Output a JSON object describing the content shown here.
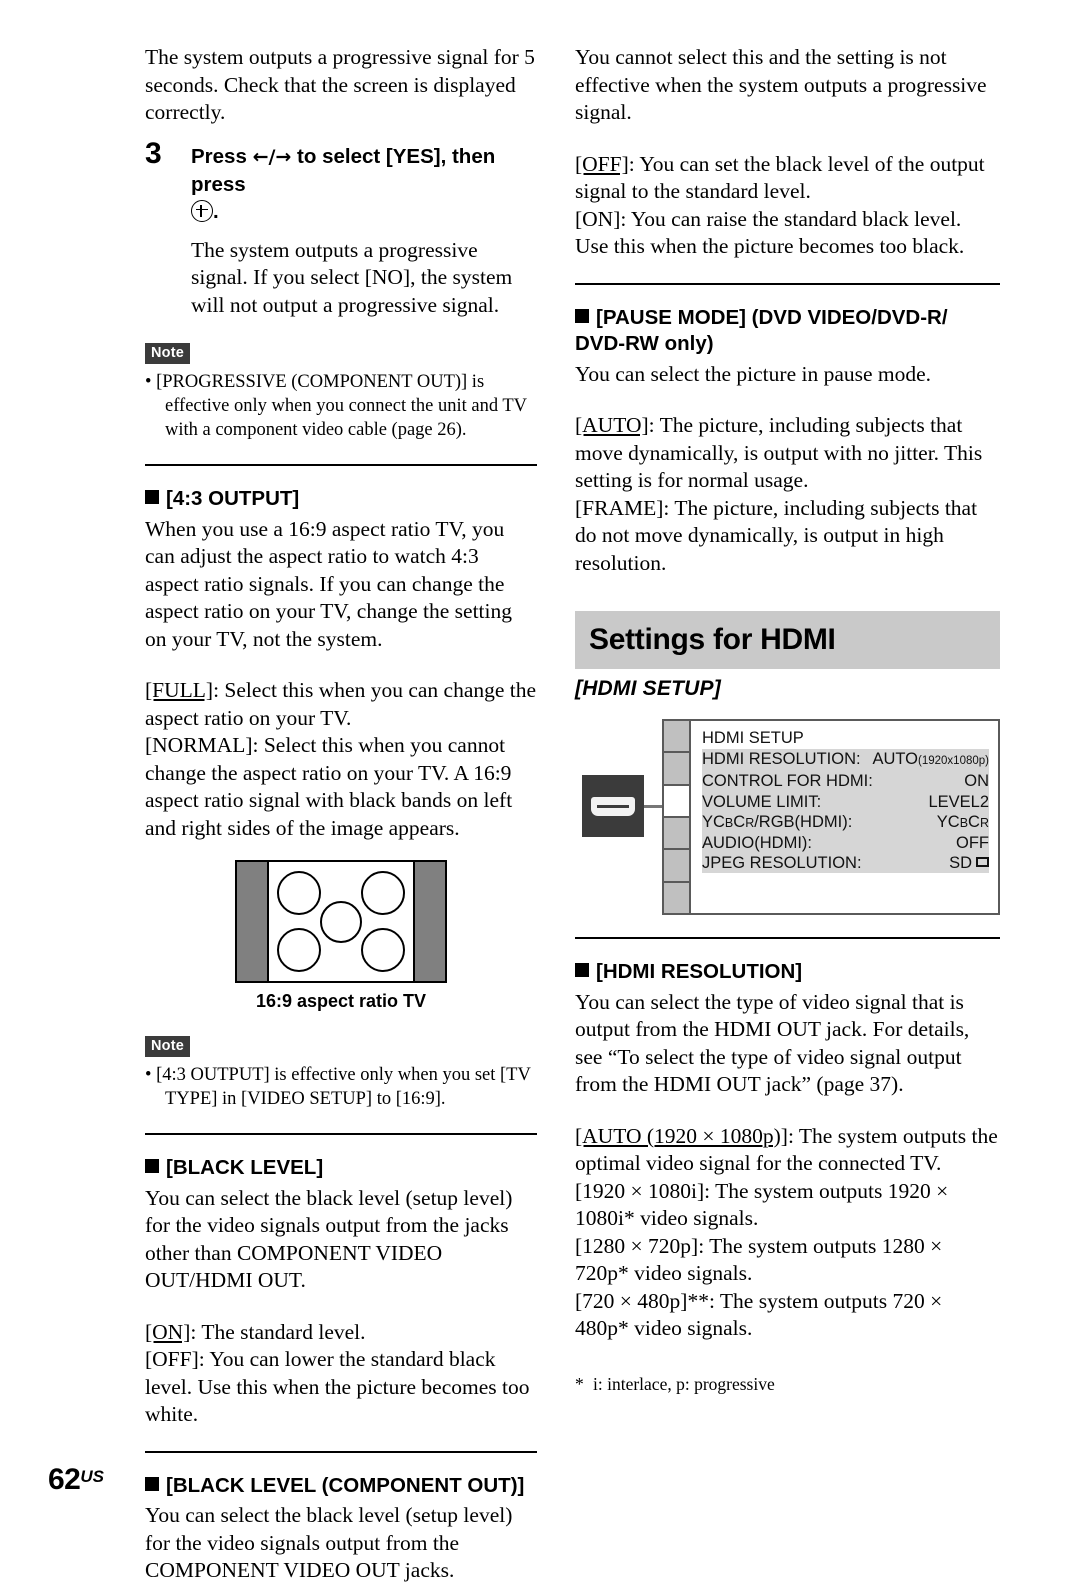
{
  "page": {
    "number": "62",
    "region_suffix": "US"
  },
  "left_column": {
    "intro_paragraph": "The system outputs a progressive signal for 5 seconds. Check that the screen is displayed correctly.",
    "step": {
      "number": "3",
      "heading_before_arrows": "Press ",
      "arrows": "←/→",
      "heading_after_arrows": " to select [YES], then press",
      "heading_tail": ".",
      "body": "The system outputs a progressive signal. If you select [NO], the system will not output a progressive signal."
    },
    "note1": {
      "badge": "Note",
      "text": "• [PROGRESSIVE (COMPONENT OUT)] is",
      "continuation": "effective only when you connect the unit and TV with a component video cable (page 26)."
    },
    "section_43_output": {
      "heading": "[4:3 OUTPUT]",
      "body": "When you use a 16:9 aspect ratio TV, you can adjust the aspect ratio to watch 4:3 aspect ratio signals. If you can change the aspect ratio on your TV, change the setting on your TV, not the system.",
      "option_full_label": "[FULL]",
      "option_full_text": ": Select this when you can change the aspect ratio on your TV.",
      "option_normal_label": "[NORMAL]",
      "option_normal_text": ": Select this when you cannot change the aspect ratio on your TV. A 16:9 aspect ratio signal with black bands on left and right sides of the image appears."
    },
    "tv_figure": {
      "caption": "16:9 aspect ratio TV"
    },
    "note2": {
      "badge": "Note",
      "text": "• [4:3 OUTPUT] is effective only when you set [TV",
      "continuation": "TYPE] in [VIDEO SETUP] to [16:9]."
    },
    "section_black_level": {
      "heading": "[BLACK LEVEL]",
      "body": "You can select the black level (setup level) for the video signals output from the jacks other than COMPONENT VIDEO OUT/HDMI OUT.",
      "option_on_label": "[ON]",
      "option_on_text": ": The standard level.",
      "option_off_label": "[OFF]",
      "option_off_text": ": You can lower the standard black level. Use this when the picture becomes too white."
    },
    "section_black_level_component": {
      "heading": "[BLACK LEVEL (COMPONENT OUT)]",
      "body": "You can select the black level (setup level) for the video signals output from the COMPONENT VIDEO OUT jacks."
    }
  },
  "right_column": {
    "intro_paragraph": "You cannot select this and the setting is not effective when the system outputs a progressive signal.",
    "black_level_component_options": {
      "option_off_label": "[OFF]",
      "option_off_text": ": You can set the black level of the output signal to the standard level.",
      "option_on_label": "[ON]",
      "option_on_text": ": You can raise the standard black level. Use this when the picture becomes too black."
    },
    "section_pause_mode": {
      "heading_line1": "[PAUSE MODE] (DVD VIDEO/DVD-R/",
      "heading_line2": "DVD-RW only)",
      "body": "You can select the picture in pause mode.",
      "option_auto_label": "[AUTO]",
      "option_auto_text": ": The picture, including subjects that move dynamically, is output with no jitter. This setting is for normal usage.",
      "option_frame_label": "[FRAME]",
      "option_frame_text": ": The picture, including subjects that do not move dynamically, is output in high resolution."
    },
    "band_title": "Settings for HDMI",
    "subsection_title": "[HDMI SETUP]",
    "osd": {
      "icon_label": "hdmi-connector-icon",
      "tabs": [
        {
          "selected": false
        },
        {
          "selected": false
        },
        {
          "selected": true
        },
        {
          "selected": false
        },
        {
          "selected": false
        },
        {
          "selected": false
        }
      ],
      "title": "HDMI SETUP",
      "rows": [
        {
          "label": "HDMI RESOLUTION:",
          "value": "AUTO",
          "value_small": "(1920x1080p)"
        },
        {
          "label": "CONTROL FOR HDMI:",
          "value": "ON",
          "value_small": ""
        },
        {
          "label": "VOLUME LIMIT:",
          "value": "LEVEL2",
          "value_small": ""
        },
        {
          "label": "YCBCR/RGB(HDMI):",
          "value": "YCBCR",
          "value_small": ""
        },
        {
          "label": "AUDIO(HDMI):",
          "value": "OFF",
          "value_small": ""
        },
        {
          "label": "JPEG RESOLUTION:",
          "value": "SD",
          "value_small": ""
        }
      ]
    },
    "section_hdmi_resolution": {
      "heading": "[HDMI RESOLUTION]",
      "body": "You can select the type of video signal that is output from the HDMI OUT jack. For details, see “To select the type of video signal output from the HDMI OUT jack” (page 37).",
      "option_auto_label": "[AUTO (1920 × 1080p)]",
      "option_auto_text": ": The system outputs the optimal video signal for the connected TV.",
      "option_1080i_label": "[1920 × 1080i]",
      "option_1080i_text": ": The system outputs 1920 × 1080i* video signals.",
      "option_720p_label": "[1280 × 720p]",
      "option_720p_text": ": The system outputs 1280 × 720p* video signals.",
      "option_480p_label": "[720 × 480p]**",
      "option_480p_text": ": The system outputs 720 × 480p* video signals."
    },
    "footnote": {
      "marker": "*",
      "text": "i: interlace, p: progressive"
    }
  },
  "colors": {
    "band_gray": "#c9c9c9",
    "note_badge": "#3b3b3b",
    "tv_band_gray": "#808080",
    "osd_list_gray": "#d6d6d6",
    "osd_tab_gray": "#c0c0c0"
  }
}
